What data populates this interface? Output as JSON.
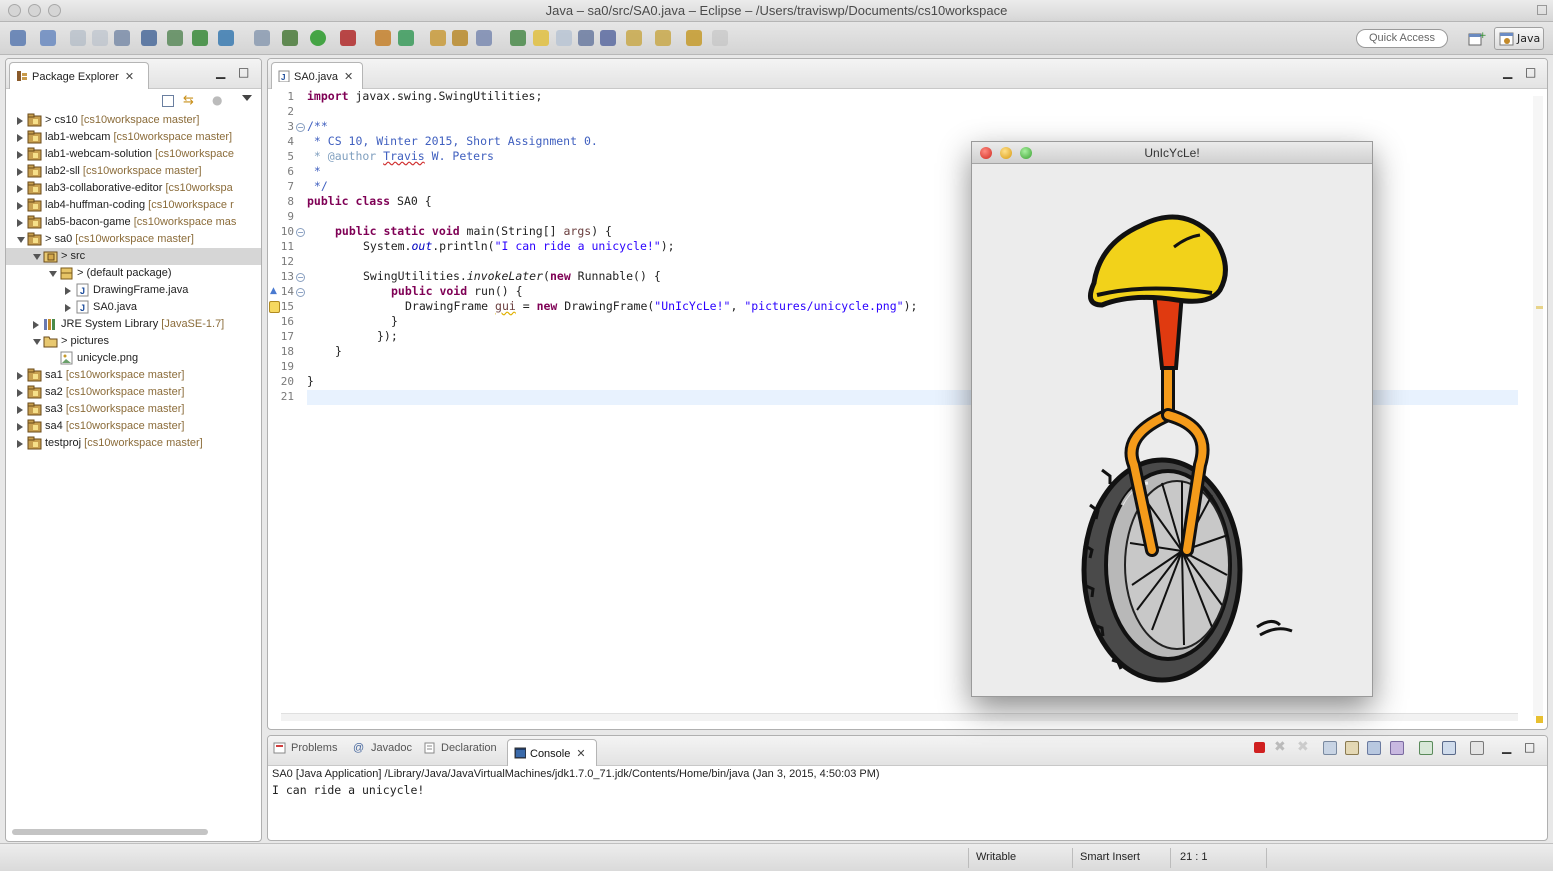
{
  "window": {
    "title": "Java – sa0/src/SA0.java – Eclipse – /Users/traviswp/Documents/cs10workspace"
  },
  "toolbar": {
    "quick_access": "Quick Access",
    "perspective": "Java",
    "icons": [
      "new-icon",
      "open-icon",
      "save-icon",
      "save-all-icon",
      "print-icon",
      "skip-breakpoints-icon",
      "terminate-icon",
      "build-icon",
      "check-icon",
      "new-project-icon",
      "debug-icon",
      "run-icon",
      "external-tools-icon",
      "new-package-icon",
      "new-class-icon",
      "open-type-icon",
      "search-icon",
      "task-icon",
      "annotation-icon",
      "highlight-icon",
      "whitespace-icon",
      "toggle-icon",
      "next-annotation-icon",
      "prev-annotation-icon",
      "last-edit-icon",
      "back-icon",
      "forward-icon"
    ]
  },
  "package_explorer": {
    "title": "Package Explorer",
    "items": [
      {
        "label": "> cs10",
        "meta": "[cs10workspace master]"
      },
      {
        "label": "lab1-webcam",
        "meta": "[cs10workspace master]"
      },
      {
        "label": "lab1-webcam-solution",
        "meta": "[cs10workspace"
      },
      {
        "label": "lab2-sll",
        "meta": "[cs10workspace master]"
      },
      {
        "label": "lab3-collaborative-editor",
        "meta": "[cs10workspa"
      },
      {
        "label": "lab4-huffman-coding",
        "meta": "[cs10workspace r"
      },
      {
        "label": "lab5-bacon-game",
        "meta": "[cs10workspace mas"
      },
      {
        "label": "> sa0",
        "meta": "[cs10workspace master]"
      },
      {
        "label": "> src",
        "meta": ""
      },
      {
        "label": "> (default package)",
        "meta": ""
      },
      {
        "label": "DrawingFrame.java",
        "meta": ""
      },
      {
        "label": "SA0.java",
        "meta": ""
      },
      {
        "label": "JRE System Library",
        "meta": "[JavaSE-1.7]"
      },
      {
        "label": "> pictures",
        "meta": ""
      },
      {
        "label": "unicycle.png",
        "meta": ""
      },
      {
        "label": "sa1",
        "meta": "[cs10workspace master]"
      },
      {
        "label": "sa2",
        "meta": "[cs10workspace master]"
      },
      {
        "label": "sa3",
        "meta": "[cs10workspace master]"
      },
      {
        "label": "sa4",
        "meta": "[cs10workspace master]"
      },
      {
        "label": "testproj",
        "meta": "[cs10workspace master]"
      }
    ]
  },
  "editor": {
    "tab": "SA0.java",
    "line_numbers": [
      "1",
      "2",
      "3",
      "4",
      "5",
      "6",
      "7",
      "8",
      "9",
      "10",
      "11",
      "12",
      "13",
      "14",
      "15",
      "16",
      "17",
      "18",
      "19",
      "20",
      "21"
    ],
    "code": {
      "l1_kw": "import",
      "l1_rest": " javax.swing.SwingUtilities;",
      "l3": "/**",
      "l4": " * CS 10, Winter 2015, Short Assignment 0.",
      "l5_a": " * @author ",
      "l5_b": "Travis",
      "l5_c": " W. Peters",
      "l6": " *",
      "l7": " */",
      "l8_kw": "public class",
      "l8_rest": " SA0 {",
      "l10_kw": "public static void",
      "l10_rest": " main(String[] ",
      "l10_args": "args",
      "l10_end": ") {",
      "l11_a": "System.",
      "l11_out": "out",
      "l11_b": ".println(",
      "l11_str": "\"I can ride a unicycle!\"",
      "l11_c": ");",
      "l13_a": "SwingUtilities.",
      "l13_it": "invokeLater",
      "l13_b": "(",
      "l13_kw": "new",
      "l13_c": " Runnable() {",
      "l14_kw": "public void",
      "l14_rest": " run() {",
      "l15_a": "DrawingFrame ",
      "l15_gui": "gui",
      "l15_b": " = ",
      "l15_kw": "new",
      "l15_c": " DrawingFrame(",
      "l15_s1": "\"UnIcYcLe!\"",
      "l15_d": ", ",
      "l15_s2": "\"pictures/unicycle.png\"",
      "l15_e": ");",
      "l16": "}",
      "l17": "});",
      "l18": "}",
      "l20": "}"
    }
  },
  "drawing_frame": {
    "title": "UnIcYcLe!"
  },
  "bottom": {
    "tabs": [
      "Problems",
      "Javadoc",
      "Declaration",
      "Console"
    ],
    "console_header": "SA0 [Java Application] /Library/Java/JavaVirtualMachines/jdk1.7.0_71.jdk/Contents/Home/bin/java (Jan 3, 2015, 4:50:03 PM)",
    "console_output": "I can ride a unicycle!"
  },
  "status": {
    "writable": "Writable",
    "insert_mode": "Smart Insert",
    "position": "21 : 1"
  },
  "colors": {
    "keyword": "#7f0055",
    "comment": "#3f5fbf",
    "string": "#2a00ff",
    "meta": "#8b6c3a",
    "seat": "#f2d21a",
    "post": "#e03a10",
    "fork": "#f59b1a"
  }
}
